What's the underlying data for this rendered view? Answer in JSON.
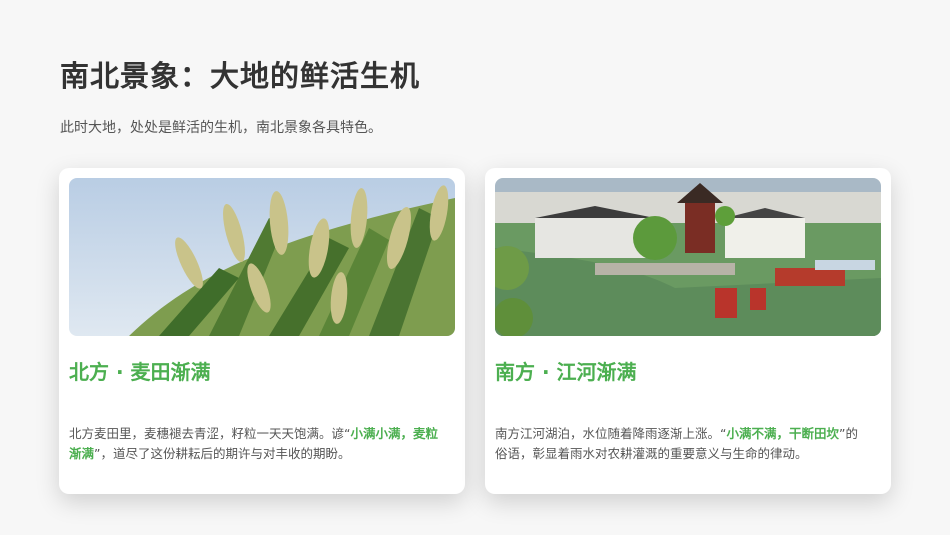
{
  "page": {
    "title": "南北景象：大地的鲜活生机",
    "subtitle": "此时大地，处处是鲜活的生机，南北景象各具特色。"
  },
  "cards": [
    {
      "title": "北方 · 麦田渐满",
      "text_before": "北方麦田里，麦穗褪去青涩，籽粒一天天饱满。谚“",
      "highlight": "小满小满，麦粒渐满",
      "text_after": "”，道尽了这份耕耘后的期许与对丰收的期盼。",
      "image": "wheat-field-photo"
    },
    {
      "title": "南方 · 江河渐满",
      "text_before": "南方江河湖泊，水位随着降雨逐渐上涨。“",
      "highlight": "小满不满，干断田坎",
      "text_after": "”的俗语，彰显着雨水对农耕灌溉的重要意义与生命的律动。",
      "image": "water-town-photo"
    }
  ],
  "colors": {
    "accent": "#4caf50",
    "title": "#333333",
    "body_text": "#555555",
    "background": "#f7f7f7"
  }
}
